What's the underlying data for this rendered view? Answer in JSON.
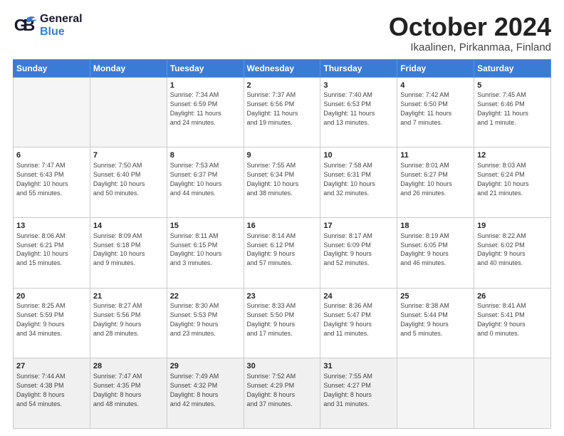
{
  "logo": {
    "general": "General",
    "blue": "Blue"
  },
  "title": "October 2024",
  "location": "Ikaalinen, Pirkanmaa, Finland",
  "weekdays": [
    "Sunday",
    "Monday",
    "Tuesday",
    "Wednesday",
    "Thursday",
    "Friday",
    "Saturday"
  ],
  "weeks": [
    [
      {
        "day": "",
        "detail": ""
      },
      {
        "day": "",
        "detail": ""
      },
      {
        "day": "1",
        "detail": "Sunrise: 7:34 AM\nSunset: 6:59 PM\nDaylight: 11 hours\nand 24 minutes."
      },
      {
        "day": "2",
        "detail": "Sunrise: 7:37 AM\nSunset: 6:56 PM\nDaylight: 11 hours\nand 19 minutes."
      },
      {
        "day": "3",
        "detail": "Sunrise: 7:40 AM\nSunset: 6:53 PM\nDaylight: 11 hours\nand 13 minutes."
      },
      {
        "day": "4",
        "detail": "Sunrise: 7:42 AM\nSunset: 6:50 PM\nDaylight: 11 hours\nand 7 minutes."
      },
      {
        "day": "5",
        "detail": "Sunrise: 7:45 AM\nSunset: 6:46 PM\nDaylight: 11 hours\nand 1 minute."
      }
    ],
    [
      {
        "day": "6",
        "detail": "Sunrise: 7:47 AM\nSunset: 6:43 PM\nDaylight: 10 hours\nand 55 minutes."
      },
      {
        "day": "7",
        "detail": "Sunrise: 7:50 AM\nSunset: 6:40 PM\nDaylight: 10 hours\nand 50 minutes."
      },
      {
        "day": "8",
        "detail": "Sunrise: 7:53 AM\nSunset: 6:37 PM\nDaylight: 10 hours\nand 44 minutes."
      },
      {
        "day": "9",
        "detail": "Sunrise: 7:55 AM\nSunset: 6:34 PM\nDaylight: 10 hours\nand 38 minutes."
      },
      {
        "day": "10",
        "detail": "Sunrise: 7:58 AM\nSunset: 6:31 PM\nDaylight: 10 hours\nand 32 minutes."
      },
      {
        "day": "11",
        "detail": "Sunrise: 8:01 AM\nSunset: 6:27 PM\nDaylight: 10 hours\nand 26 minutes."
      },
      {
        "day": "12",
        "detail": "Sunrise: 8:03 AM\nSunset: 6:24 PM\nDaylight: 10 hours\nand 21 minutes."
      }
    ],
    [
      {
        "day": "13",
        "detail": "Sunrise: 8:06 AM\nSunset: 6:21 PM\nDaylight: 10 hours\nand 15 minutes."
      },
      {
        "day": "14",
        "detail": "Sunrise: 8:09 AM\nSunset: 6:18 PM\nDaylight: 10 hours\nand 9 minutes."
      },
      {
        "day": "15",
        "detail": "Sunrise: 8:11 AM\nSunset: 6:15 PM\nDaylight: 10 hours\nand 3 minutes."
      },
      {
        "day": "16",
        "detail": "Sunrise: 8:14 AM\nSunset: 6:12 PM\nDaylight: 9 hours\nand 57 minutes."
      },
      {
        "day": "17",
        "detail": "Sunrise: 8:17 AM\nSunset: 6:09 PM\nDaylight: 9 hours\nand 52 minutes."
      },
      {
        "day": "18",
        "detail": "Sunrise: 8:19 AM\nSunset: 6:05 PM\nDaylight: 9 hours\nand 46 minutes."
      },
      {
        "day": "19",
        "detail": "Sunrise: 8:22 AM\nSunset: 6:02 PM\nDaylight: 9 hours\nand 40 minutes."
      }
    ],
    [
      {
        "day": "20",
        "detail": "Sunrise: 8:25 AM\nSunset: 5:59 PM\nDaylight: 9 hours\nand 34 minutes."
      },
      {
        "day": "21",
        "detail": "Sunrise: 8:27 AM\nSunset: 5:56 PM\nDaylight: 9 hours\nand 28 minutes."
      },
      {
        "day": "22",
        "detail": "Sunrise: 8:30 AM\nSunset: 5:53 PM\nDaylight: 9 hours\nand 23 minutes."
      },
      {
        "day": "23",
        "detail": "Sunrise: 8:33 AM\nSunset: 5:50 PM\nDaylight: 9 hours\nand 17 minutes."
      },
      {
        "day": "24",
        "detail": "Sunrise: 8:36 AM\nSunset: 5:47 PM\nDaylight: 9 hours\nand 11 minutes."
      },
      {
        "day": "25",
        "detail": "Sunrise: 8:38 AM\nSunset: 5:44 PM\nDaylight: 9 hours\nand 5 minutes."
      },
      {
        "day": "26",
        "detail": "Sunrise: 8:41 AM\nSunset: 5:41 PM\nDaylight: 9 hours\nand 0 minutes."
      }
    ],
    [
      {
        "day": "27",
        "detail": "Sunrise: 7:44 AM\nSunset: 4:38 PM\nDaylight: 8 hours\nand 54 minutes."
      },
      {
        "day": "28",
        "detail": "Sunrise: 7:47 AM\nSunset: 4:35 PM\nDaylight: 8 hours\nand 48 minutes."
      },
      {
        "day": "29",
        "detail": "Sunrise: 7:49 AM\nSunset: 4:32 PM\nDaylight: 8 hours\nand 42 minutes."
      },
      {
        "day": "30",
        "detail": "Sunrise: 7:52 AM\nSunset: 4:29 PM\nDaylight: 8 hours\nand 37 minutes."
      },
      {
        "day": "31",
        "detail": "Sunrise: 7:55 AM\nSunset: 4:27 PM\nDaylight: 8 hours\nand 31 minutes."
      },
      {
        "day": "",
        "detail": ""
      },
      {
        "day": "",
        "detail": ""
      }
    ]
  ]
}
